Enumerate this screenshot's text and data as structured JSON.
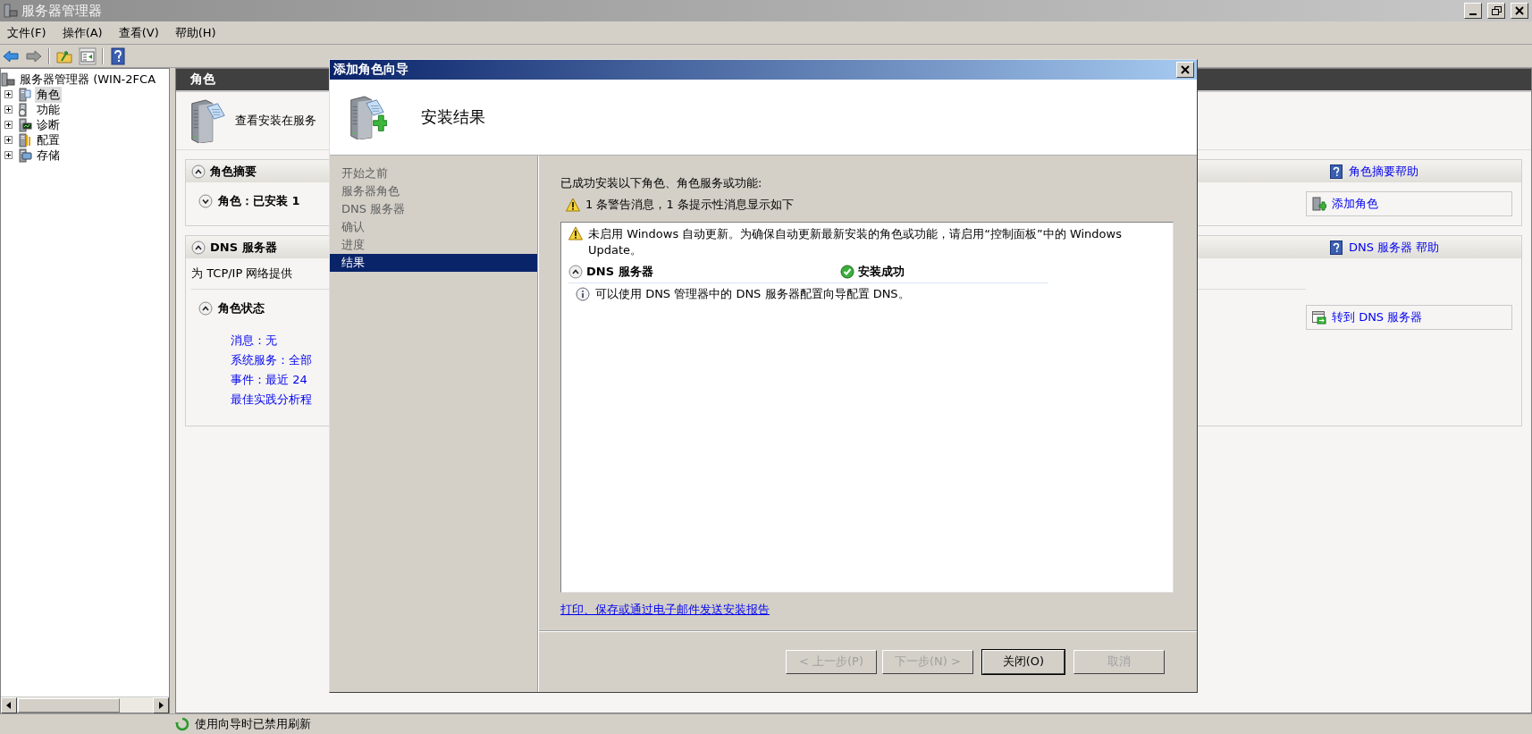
{
  "window": {
    "title": "服务器管理器"
  },
  "menu": [
    "文件(F)",
    "操作(A)",
    "查看(V)",
    "帮助(H)"
  ],
  "tree": [
    {
      "label": "服务器管理器 (WIN-2FCA",
      "selected": false,
      "children": [
        {
          "label": "角色",
          "expanded": false,
          "selected": true
        },
        {
          "label": "功能",
          "expanded": false,
          "selected": false
        },
        {
          "label": "诊断",
          "expanded": false,
          "selected": false
        },
        {
          "label": "配置",
          "expanded": false,
          "selected": false
        },
        {
          "label": "存储",
          "expanded": false,
          "selected": false
        }
      ]
    }
  ],
  "content": {
    "header": "角色",
    "description": "查看安装在服务",
    "sections": [
      {
        "title": "角色摘要",
        "expanded": true,
        "help": "角色摘要帮助",
        "subheader": {
          "label": "角色：已安装 1",
          "expanded": false
        },
        "action": {
          "kind": "add",
          "label": "添加角色"
        }
      },
      {
        "title": "DNS 服务器",
        "expanded": true,
        "help": "DNS 服务器 帮助",
        "intro": "为 TCP/IP 网络提供",
        "subheader": {
          "label": "角色状态",
          "expanded": true
        },
        "links": [
          "消息：无",
          "系统服务：全部",
          "事件：最近 24",
          "最佳实践分析程"
        ],
        "action": {
          "kind": "goto",
          "label": "转到 DNS 服务器"
        }
      }
    ]
  },
  "status_bar": "使用向导时已禁用刷新",
  "dialog": {
    "title": "添加角色向导",
    "heading": "安装结果",
    "steps": [
      {
        "label": "开始之前",
        "selected": false
      },
      {
        "label": "服务器角色",
        "selected": false
      },
      {
        "label": "DNS 服务器",
        "selected": false
      },
      {
        "label": "确认",
        "selected": false
      },
      {
        "label": "进度",
        "selected": false
      },
      {
        "label": "结果",
        "selected": true
      }
    ],
    "summary": "已成功安装以下角色、角色服务或功能:",
    "notice": "1 条警告消息，1 条提示性消息显示如下",
    "results": {
      "warning": "未启用 Windows 自动更新。为确保自动更新最新安装的角色或功能，请启用“控制面板”中的 Windows Update。",
      "role": "DNS 服务器",
      "expanded": true,
      "status": "安装成功",
      "info": "可以使用 DNS 管理器中的 DNS 服务器配置向导配置 DNS。"
    },
    "report_link": "打印、保存或通过电子邮件发送安装报告",
    "buttons": [
      {
        "label": "< 上一步(P)",
        "disabled": true,
        "default": false
      },
      {
        "label": "下一步(N) >",
        "disabled": true,
        "default": false
      },
      {
        "label": "关闭(O)",
        "disabled": false,
        "default": true
      },
      {
        "label": "取消",
        "disabled": true,
        "default": false
      }
    ]
  }
}
